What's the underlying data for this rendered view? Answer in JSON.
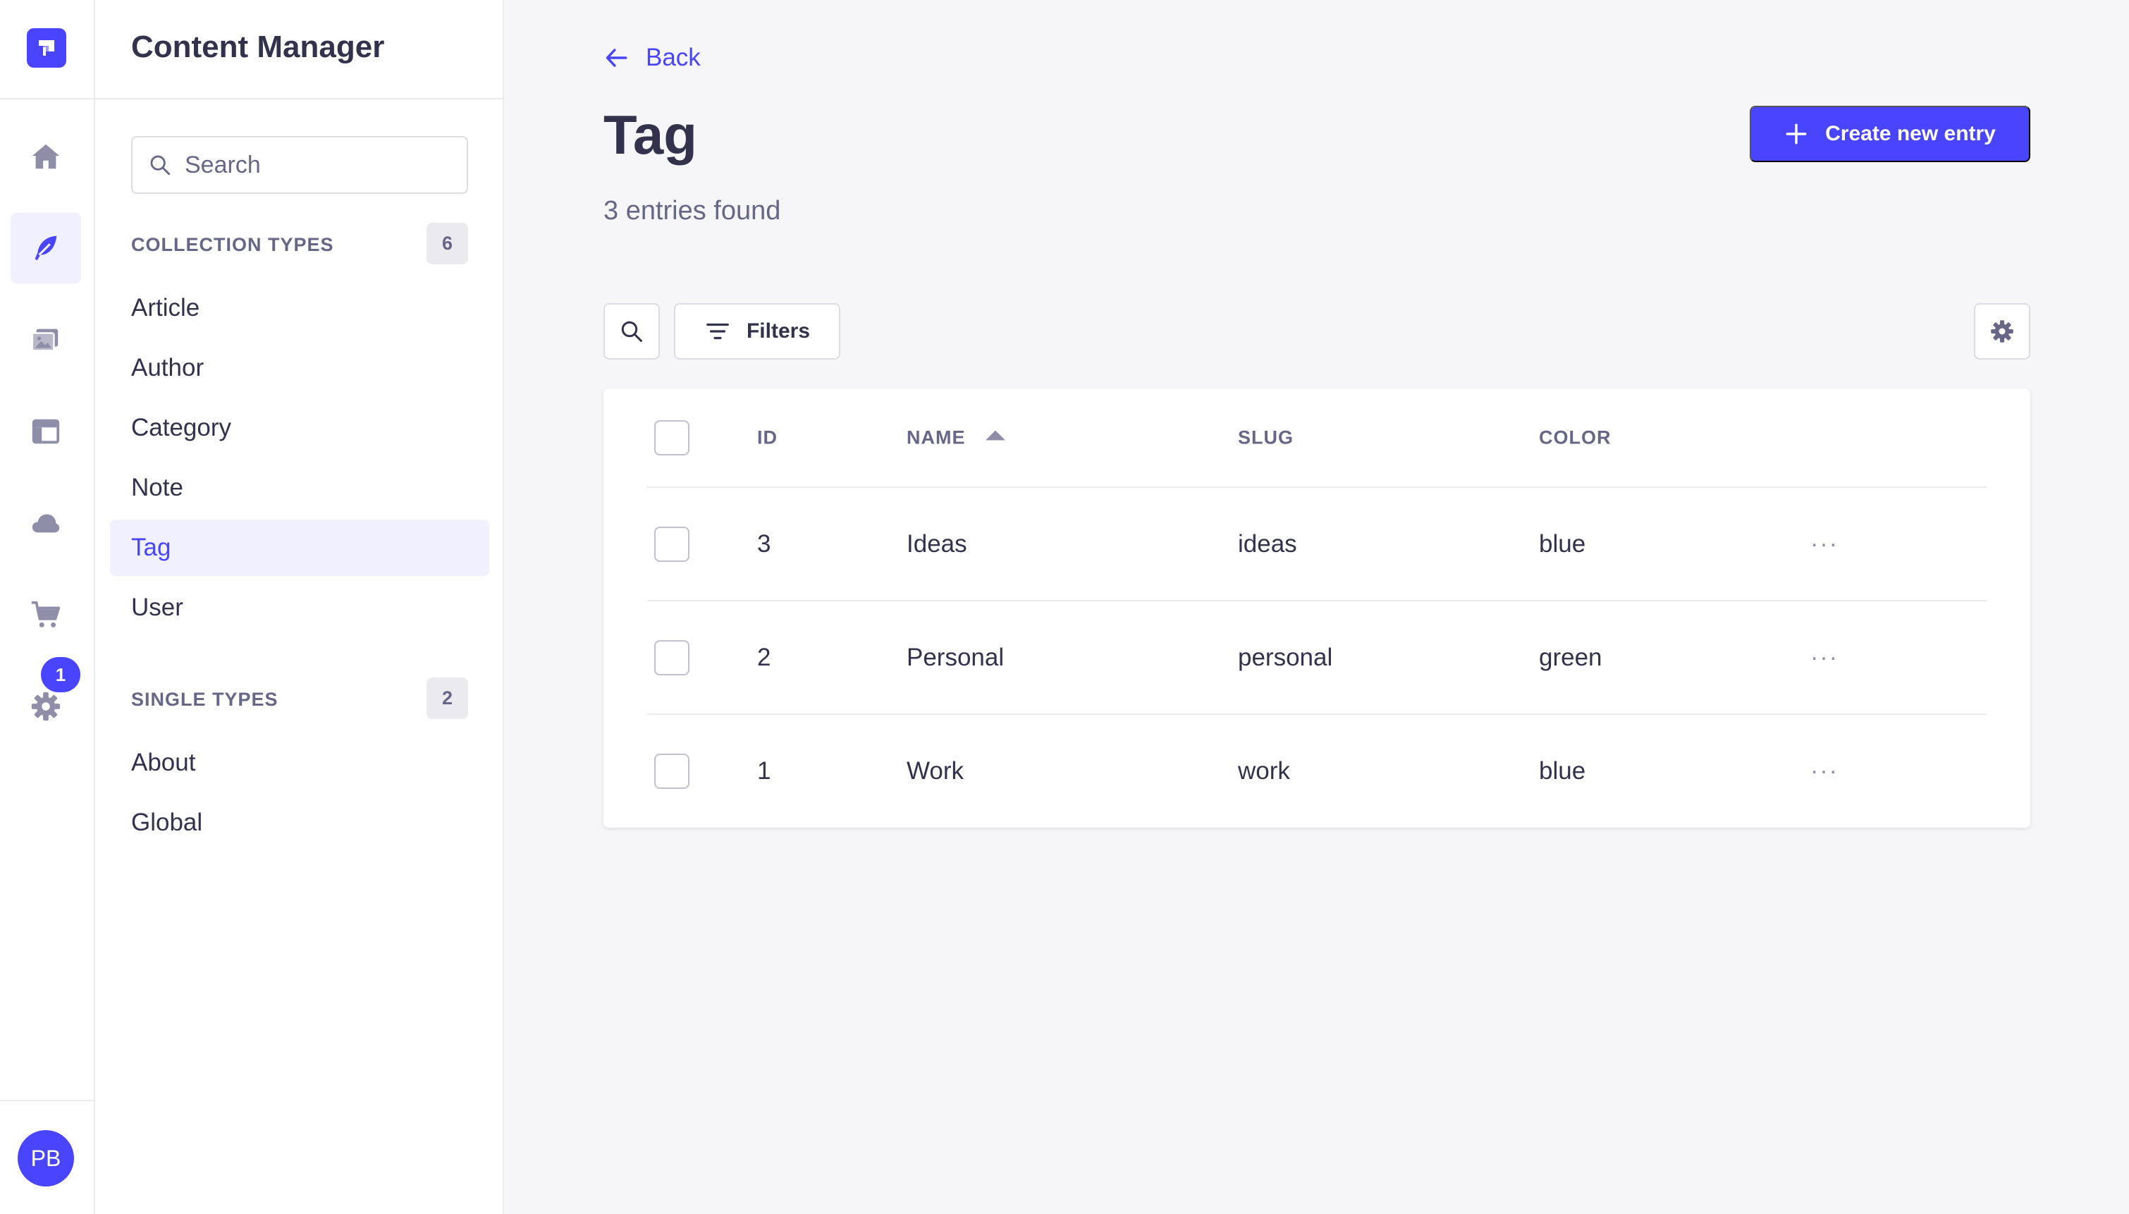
{
  "app": {
    "nav_icons": [
      "home-icon",
      "content-manager-icon",
      "media-library-icon",
      "content-type-builder-icon",
      "cloud-icon",
      "marketplace-icon",
      "settings-icon"
    ],
    "settings_badge": "1",
    "user_initials": "PB"
  },
  "subnav": {
    "title": "Content Manager",
    "search_placeholder": "Search",
    "collection_types": {
      "label": "COLLECTION TYPES",
      "count": "6",
      "items": [
        "Article",
        "Author",
        "Category",
        "Note",
        "Tag",
        "User"
      ],
      "active": "Tag"
    },
    "single_types": {
      "label": "SINGLE TYPES",
      "count": "2",
      "items": [
        "About",
        "Global"
      ]
    }
  },
  "main": {
    "back_label": "Back",
    "title": "Tag",
    "subtitle": "3 entries found",
    "create_label": "Create new entry",
    "filters_label": "Filters",
    "table": {
      "columns": [
        "ID",
        "NAME",
        "SLUG",
        "COLOR"
      ],
      "sorted_column": "NAME",
      "rows": [
        {
          "id": "3",
          "name": "Ideas",
          "slug": "ideas",
          "color": "blue"
        },
        {
          "id": "2",
          "name": "Personal",
          "slug": "personal",
          "color": "green"
        },
        {
          "id": "1",
          "name": "Work",
          "slug": "work",
          "color": "blue"
        }
      ],
      "row_actions_glyph": "···"
    }
  },
  "colors": {
    "primary": "#4945ff",
    "primary_light": "#f0f0ff",
    "text": "#32324d",
    "muted": "#666687",
    "border": "#dcdce4",
    "background": "#f6f6f9"
  }
}
